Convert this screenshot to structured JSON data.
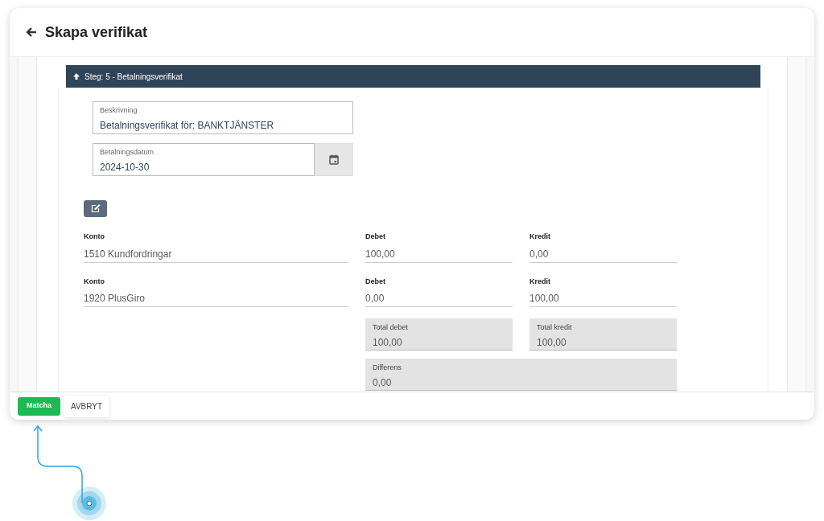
{
  "header": {
    "title": "Skapa verifikat"
  },
  "step": {
    "label": "Steg: 5 - Betalningsverifikat"
  },
  "description": {
    "label": "Beskrivning",
    "value": "Betalningsverifikat för: BANKTJÄNSTER"
  },
  "payment_date": {
    "label": "Betalningsdatum",
    "value": "2024-10-30"
  },
  "entries": [
    {
      "account_label": "Konto",
      "account": "1510 Kundfordringar",
      "debit_label": "Debet",
      "debit": "100,00",
      "credit_label": "Kredit",
      "credit": "0,00"
    },
    {
      "account_label": "Konto",
      "account": "1920 PlusGiro",
      "debit_label": "Debet",
      "debit": "0,00",
      "credit_label": "Kredit",
      "credit": "100,00"
    }
  ],
  "totals": [
    {
      "label": "Total debet",
      "value": "100,00"
    },
    {
      "label": "Total kredit",
      "value": "100,00"
    },
    {
      "label": "Differens",
      "value": "0,00"
    }
  ],
  "buttons": [
    {
      "label": "Matcha",
      "kind": "primary"
    },
    {
      "label": "AVBRYT",
      "kind": "secondary"
    }
  ]
}
